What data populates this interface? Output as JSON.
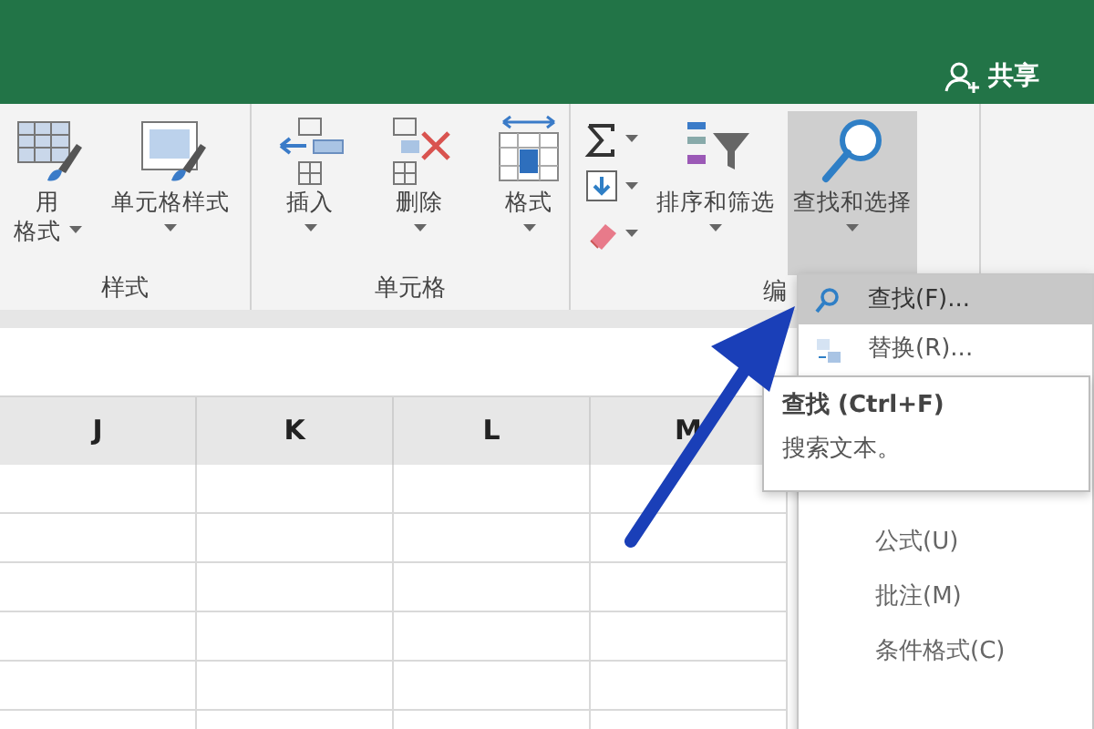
{
  "title_bar": {
    "share_label": "共享"
  },
  "ribbon": {
    "groups": [
      {
        "label": "样式",
        "items": [
          {
            "kind": "large",
            "lines": [
              "用",
              "格式"
            ],
            "selected": false
          },
          {
            "kind": "large",
            "lines": [
              "单元格样式"
            ],
            "selected": false
          }
        ]
      },
      {
        "label": "单元格",
        "items": [
          {
            "kind": "large",
            "lines": [
              "插入"
            ],
            "selected": false
          },
          {
            "kind": "large",
            "lines": [
              "删除"
            ],
            "selected": false
          },
          {
            "kind": "large",
            "lines": [
              "格式"
            ],
            "selected": false
          }
        ]
      },
      {
        "label": "编",
        "items": [
          {
            "kind": "stack"
          },
          {
            "kind": "large",
            "lines": [
              "排序和筛选"
            ],
            "selected": false
          },
          {
            "kind": "large",
            "lines": [
              "查找和选择"
            ],
            "selected": true
          }
        ]
      }
    ]
  },
  "sheet": {
    "columns": [
      "J",
      "K",
      "L",
      "M"
    ]
  },
  "menu": {
    "items_top": [
      {
        "label": "查找(F)...",
        "selected": true
      },
      {
        "label": "替换(R)...",
        "selected": false
      }
    ],
    "items_bottom": [
      {
        "label": "公式(U)",
        "selected": false
      },
      {
        "label": "批注(M)",
        "selected": false
      },
      {
        "label": "条件格式(C)",
        "selected": false
      }
    ]
  },
  "tooltip": {
    "title": "查找 (Ctrl+F)",
    "text": "搜索文本。"
  }
}
